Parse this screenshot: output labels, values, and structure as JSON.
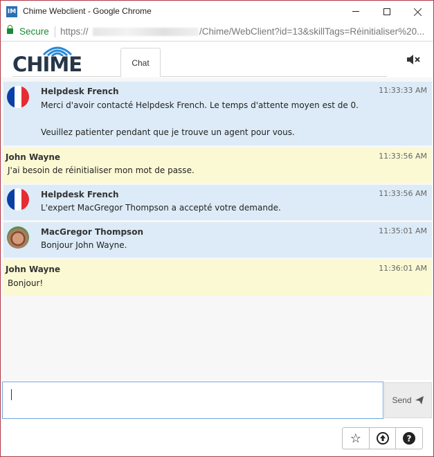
{
  "window": {
    "title": "Chime Webclient - Google Chrome",
    "app_icon_text": "IM"
  },
  "address_bar": {
    "secure_label": "Secure",
    "url_scheme": "https://",
    "url_path": "/Chime/WebClient?id=13&skillTags=Réinitialiser%20..."
  },
  "header": {
    "logo_text": "CHIME",
    "tabs": [
      {
        "label": "Chat"
      }
    ],
    "mute_icon": "speaker-mute-icon"
  },
  "messages": [
    {
      "kind": "agent",
      "sender": "Helpdesk French",
      "time": "11:33:33 AM",
      "avatar": "france-flag",
      "lines": [
        "Merci d'avoir contacté Helpdesk French. Le temps d'attente moyen est de 0.",
        "Veuillez patienter pendant que je trouve un agent pour vous."
      ]
    },
    {
      "kind": "user",
      "sender": "John Wayne",
      "time": "11:33:56 AM",
      "lines": [
        "J'ai besoin de réinitialiser mon mot de passe."
      ]
    },
    {
      "kind": "agent",
      "sender": "Helpdesk French",
      "time": "11:33:56 AM",
      "avatar": "france-flag",
      "lines": [
        "L'expert MacGregor Thompson a accepté votre demande."
      ]
    },
    {
      "kind": "agent",
      "sender": "MacGregor Thompson",
      "time": "11:35:01 AM",
      "avatar": "agent-photo",
      "lines": [
        "Bonjour John Wayne."
      ]
    },
    {
      "kind": "user",
      "sender": "John Wayne",
      "time": "11:36:01 AM",
      "lines": [
        "Bonjour!"
      ]
    }
  ],
  "composer": {
    "value": "",
    "send_label": "Send",
    "send_icon": "paper-plane-icon"
  },
  "footer": {
    "buttons": [
      {
        "icon": "star-icon",
        "glyph": "☆"
      },
      {
        "icon": "upload-icon",
        "glyph": "⬆"
      },
      {
        "icon": "help-icon",
        "glyph": "?"
      }
    ]
  },
  "colors": {
    "agent_bg": "#dcebf7",
    "user_bg": "#fbf9d4",
    "secure_green": "#1a8a34",
    "logo_blue": "#2b8ad6",
    "logo_dark": "#263648",
    "window_border": "#b03a48"
  }
}
